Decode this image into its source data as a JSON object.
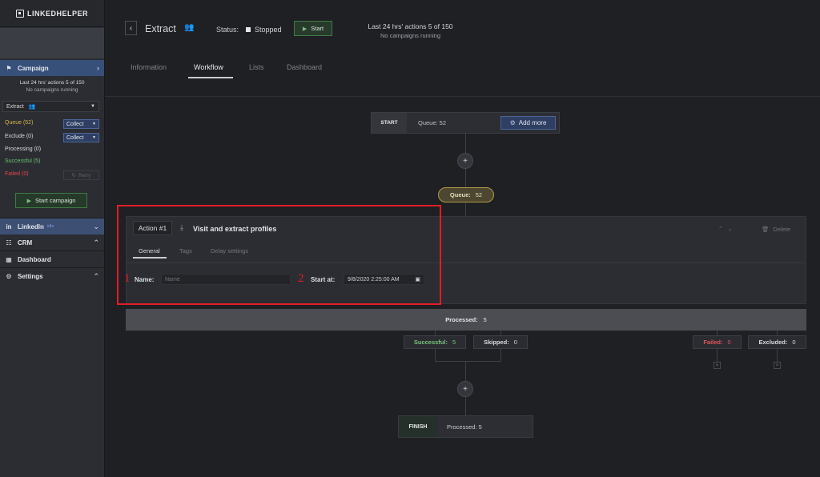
{
  "sidebar": {
    "logo": "LINKEDHELPER",
    "campaign_label": "Campaign",
    "limits_line1": "Last 24 hrs' actions 5 of 150",
    "limits_line2": "No campaigns running",
    "campaign_select": "Extract",
    "queue": "Queue (52)",
    "exclude": "Exclude (0)",
    "processing": "Processing (0)",
    "successful": "Successful (5)",
    "failed": "Failed (0)",
    "collect_label": "Collect",
    "retry_label": "Retry",
    "start_campaign": "Start campaign",
    "linkedin_label": "LinkedIn",
    "linkedin_status": "idle",
    "crm_label": "CRM",
    "dashboard_label": "Dashboard",
    "settings_label": "Settings",
    "colors": {
      "queue": "#d9b44a",
      "successful": "#6cc070",
      "failed": "#e0464f",
      "active": "#36507a"
    }
  },
  "header": {
    "title": "Extract",
    "status_label": "Status:",
    "status_value": "Stopped",
    "start_label": "Start",
    "limits_line1": "Last 24 hrs' actions 5 of 150",
    "limits_line2": "No campaigns running"
  },
  "tabs": [
    "Information",
    "Workflow",
    "Lists",
    "Dashboard"
  ],
  "workflow": {
    "start_tag": "START",
    "start_queue": "Queue: 52",
    "add_more": "Add more",
    "queue_pill_label": "Queue:",
    "queue_pill_value": "52",
    "action": {
      "tag": "Action #1",
      "title": "Visit and extract profiles",
      "delete_label": "Delete",
      "sub_tabs": [
        "General",
        "Tags",
        "Delay settings"
      ],
      "name_label": "Name:",
      "name_placeholder": "Name",
      "start_at_label": "Start at:",
      "start_at_value": "9/8/2020 2:25:00 AM"
    },
    "annotation_1": "1",
    "annotation_2": "2",
    "processed_label": "Processed:",
    "processed_value": "5",
    "results": {
      "successful_label": "Successful:",
      "successful_value": "5",
      "skipped_label": "Skipped:",
      "skipped_value": "0",
      "failed_label": "Failed:",
      "failed_value": "0",
      "excluded_label": "Excluded:",
      "excluded_value": "0"
    },
    "finish_tag": "FINISH",
    "finish_text": "Processed: 5"
  }
}
